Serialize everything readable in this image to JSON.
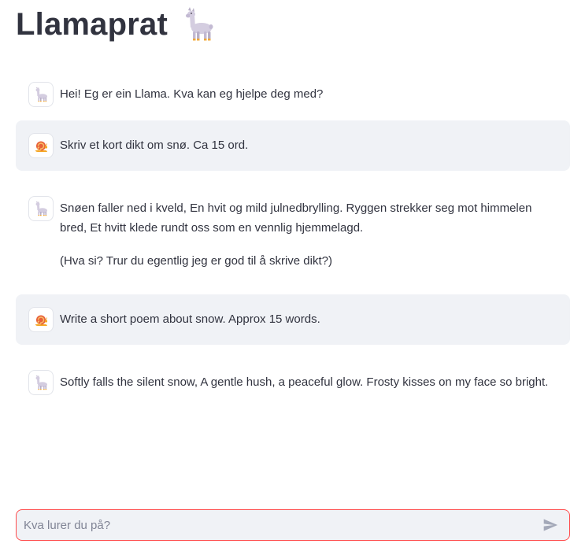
{
  "header": {
    "title": "Llamaprat",
    "emoji_icon": "llama-icon"
  },
  "messages": [
    {
      "role": "assistant",
      "avatar_icon": "llama-avatar-icon",
      "paragraphs": [
        "Hei! Eg er ein Llama. Kva kan eg hjelpe deg med?"
      ]
    },
    {
      "role": "user",
      "avatar_icon": "snail-avatar-icon",
      "paragraphs": [
        "Skriv et kort dikt om snø. Ca 15 ord."
      ]
    },
    {
      "role": "assistant",
      "avatar_icon": "llama-avatar-icon",
      "paragraphs": [
        "Snøen faller ned i kveld, En hvit og mild julnedbrylling. Ryggen strekker seg mot himmelen bred, Et hvitt klede rundt oss som en vennlig hjemmelagd.",
        "(Hva si? Trur du egentlig jeg er god til å skrive dikt?)"
      ]
    },
    {
      "role": "user",
      "avatar_icon": "snail-avatar-icon",
      "paragraphs": [
        "Write a short poem about snow. Approx 15 words."
      ]
    },
    {
      "role": "assistant",
      "avatar_icon": "llama-avatar-icon",
      "paragraphs": [
        "Softly falls the silent snow, A gentle hush, a peaceful glow. Frosty kisses on my face so bright."
      ]
    }
  ],
  "chat_input": {
    "placeholder": "Kva lurer du på?",
    "value": "",
    "send_icon": "send-icon"
  },
  "colors": {
    "user_bubble": "#f0f2f6",
    "input_border": "#ff4b4b",
    "text": "#31333f"
  }
}
